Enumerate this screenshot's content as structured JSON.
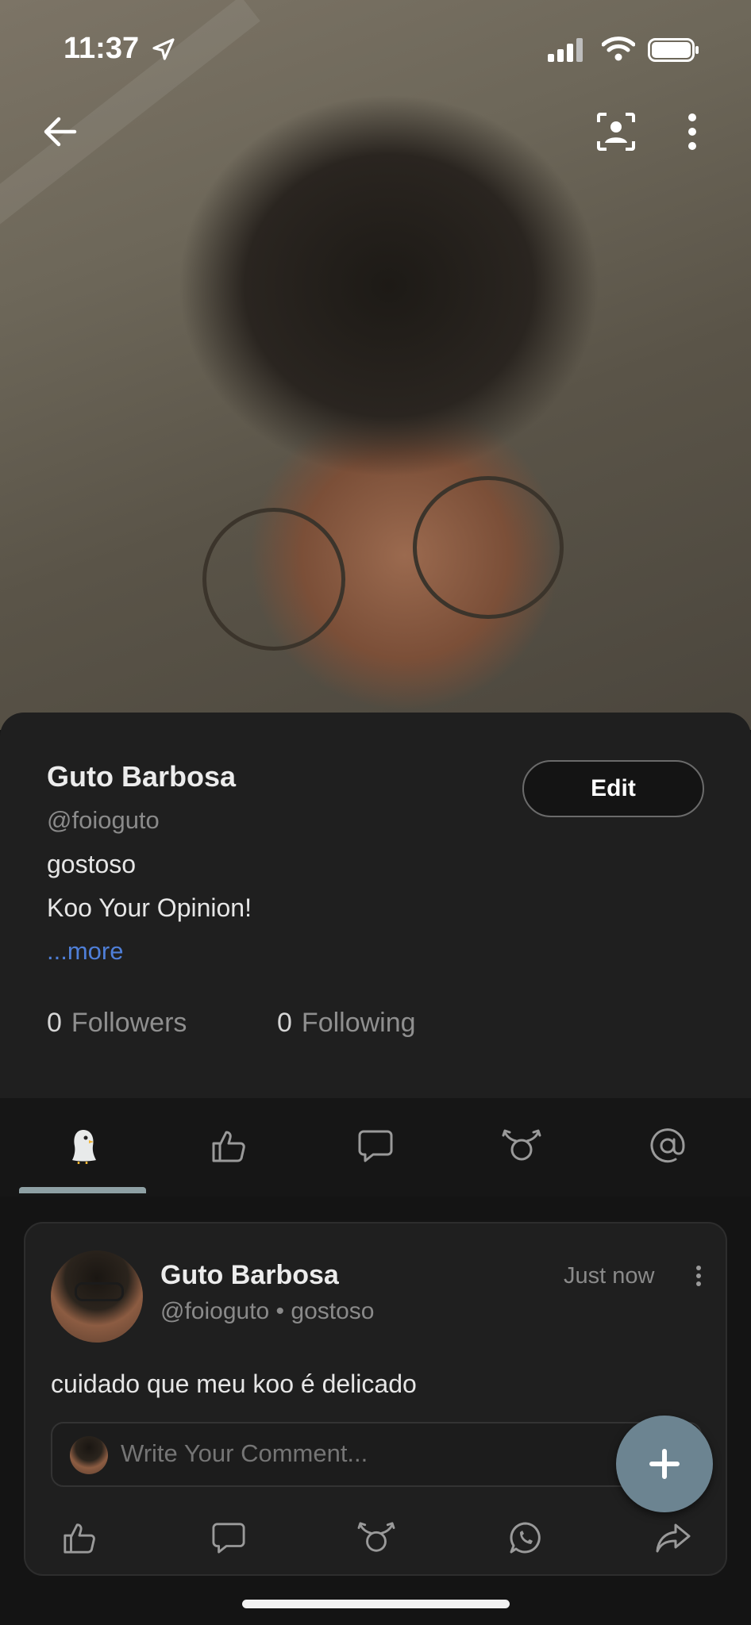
{
  "status_bar": {
    "time": "11:37"
  },
  "profile": {
    "name": "Guto Barbosa",
    "handle": "@foioguto",
    "bio_line1": "gostoso",
    "bio_line2": "Koo Your Opinion!",
    "more_link": "...more",
    "edit_label": "Edit",
    "followers_count": "0",
    "followers_label": "Followers",
    "following_count": "0",
    "following_label": "Following"
  },
  "tabs": [
    {
      "name": "koos-tab",
      "icon": "koo-bird-icon",
      "active": true
    },
    {
      "name": "likes-tab",
      "icon": "thumbs-up-icon",
      "active": false
    },
    {
      "name": "comments-tab",
      "icon": "comment-icon",
      "active": false
    },
    {
      "name": "rekoos-tab",
      "icon": "rekoo-icon",
      "active": false
    },
    {
      "name": "mentions-tab",
      "icon": "at-sign-icon",
      "active": false
    }
  ],
  "post": {
    "author_name": "Guto Barbosa",
    "author_meta": "@foioguto • gostoso",
    "time": "Just now",
    "text": "cuidado que meu koo é delicado",
    "comment_placeholder": "Write Your Comment..."
  },
  "colors": {
    "card_bg": "#1f1f1f",
    "page_bg": "#141414",
    "link": "#4f7fd8",
    "fab": "#6c8491",
    "tab_indicator": "#8ea0a4"
  }
}
